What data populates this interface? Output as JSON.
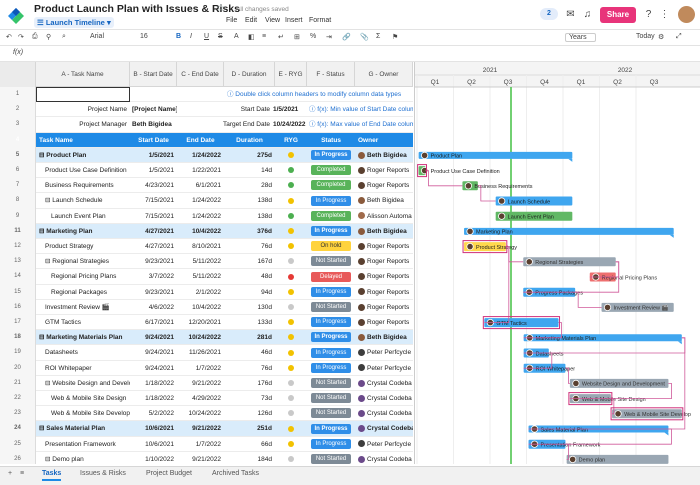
{
  "app": {
    "title": "Product Launch Plan with Issues & Risks",
    "saved_status": "All changes saved",
    "view_selector": "Launch Timeline",
    "menus": [
      "File",
      "Edit",
      "View",
      "Insert",
      "Format"
    ],
    "share_label": "Share",
    "collab_count": "2"
  },
  "toolbar": {
    "font": "Arial",
    "size": "16",
    "bold": "B",
    "italic": "I",
    "underline": "U",
    "strike": "S",
    "zoom_select": "Years",
    "today_label": "Today"
  },
  "formula_bar": {
    "label": "f(x)"
  },
  "columns": {
    "a": "A - Task Name",
    "b": "B - Start Date",
    "c": "C - End Date",
    "d": "D - Duration",
    "e": "E - RYG",
    "f": "F - Status",
    "g": "G - Owner"
  },
  "meta_rows": [
    {
      "num": "1",
      "label": "",
      "value": "",
      "label2": "",
      "value2": "",
      "hint": "Double click column headers to modify column data types"
    },
    {
      "num": "2",
      "label": "Project Name",
      "value": "[Project Name]",
      "label2": "Start Date",
      "value2": "1/5/2021",
      "hint": "f(x): Min value of Start Date colum"
    },
    {
      "num": "3",
      "label": "Project Manager",
      "value": "Beth Bigidea",
      "label2": "Target End Date",
      "value2": "10/24/2022",
      "hint": "f(x): Max value of End Date colum"
    }
  ],
  "table_header": {
    "num": "4",
    "task": "Task Name",
    "start": "Start Date",
    "end": "End Date",
    "duration": "Duration",
    "ryg": "RYG",
    "status": "Status",
    "owner": "Owner"
  },
  "rows": [
    {
      "num": "5",
      "task": "Product Plan",
      "start": "1/5/2021",
      "end": "1/24/2022",
      "duration": "275d",
      "ryg": "yellow",
      "status": "In Progress",
      "owner": "Beth Bigidea",
      "group": true,
      "indent": 0
    },
    {
      "num": "6",
      "task": "Product Use Case Definition",
      "start": "1/5/2021",
      "end": "1/22/2021",
      "duration": "14d",
      "ryg": "green",
      "status": "Completed",
      "owner": "Roger Reports",
      "group": false,
      "indent": 1
    },
    {
      "num": "7",
      "task": "Business Requirements",
      "start": "4/23/2021",
      "end": "6/1/2021",
      "duration": "28d",
      "ryg": "green",
      "status": "Completed",
      "owner": "Roger Reports",
      "group": false,
      "indent": 1
    },
    {
      "num": "8",
      "task": "Launch Schedule",
      "start": "7/15/2021",
      "end": "1/24/2022",
      "duration": "138d",
      "ryg": "yellow",
      "status": "In Progress",
      "owner": "Beth Bigidea",
      "group": false,
      "indent": 1
    },
    {
      "num": "9",
      "task": "Launch Event Plan",
      "start": "7/15/2021",
      "end": "1/24/2022",
      "duration": "138d",
      "ryg": "green",
      "status": "Completed",
      "owner": "Alisson Automa",
      "group": false,
      "indent": 2
    },
    {
      "num": "11",
      "task": "Marketing Plan",
      "start": "4/27/2021",
      "end": "10/4/2022",
      "duration": "376d",
      "ryg": "yellow",
      "status": "In Progress",
      "owner": "Beth Bigidea",
      "group": true,
      "indent": 0
    },
    {
      "num": "12",
      "task": "Product Strategy",
      "start": "4/27/2021",
      "end": "8/10/2021",
      "duration": "76d",
      "ryg": "yellow",
      "status": "On hold",
      "owner": "Roger Reports",
      "group": false,
      "indent": 1
    },
    {
      "num": "13",
      "task": "Regional Strategies",
      "start": "9/23/2021",
      "end": "5/11/2022",
      "duration": "167d",
      "ryg": "grey",
      "status": "Not Started",
      "owner": "Roger Reports",
      "group": false,
      "indent": 1
    },
    {
      "num": "14",
      "task": "Regional Pricing Plans",
      "start": "3/7/2022",
      "end": "5/11/2022",
      "duration": "48d",
      "ryg": "red",
      "status": "Delayed",
      "owner": "Roger Reports",
      "group": false,
      "indent": 2
    },
    {
      "num": "15",
      "task": "Regional Packages",
      "start": "9/23/2021",
      "end": "2/1/2022",
      "duration": "94d",
      "ryg": "yellow",
      "status": "In Progress",
      "owner": "Roger Reports",
      "group": false,
      "indent": 2
    },
    {
      "num": "16",
      "task": "Investment Review 🎬",
      "start": "4/6/2022",
      "end": "10/4/2022",
      "duration": "130d",
      "ryg": "grey",
      "status": "Not Started",
      "owner": "Roger Reports",
      "group": false,
      "indent": 1
    },
    {
      "num": "17",
      "task": "GTM Tactics",
      "start": "6/17/2021",
      "end": "12/20/2021",
      "duration": "133d",
      "ryg": "yellow",
      "status": "In Progress",
      "owner": "Roger Reports",
      "group": false,
      "indent": 1
    },
    {
      "num": "18",
      "task": "Marketing Materials Plan",
      "start": "9/24/2021",
      "end": "10/24/2022",
      "duration": "281d",
      "ryg": "yellow",
      "status": "In Progress",
      "owner": "Beth Bigidea",
      "group": true,
      "indent": 0
    },
    {
      "num": "19",
      "task": "Datasheets",
      "start": "9/24/2021",
      "end": "11/26/2021",
      "duration": "46d",
      "ryg": "yellow",
      "status": "In Progress",
      "owner": "Peter Perfcycle",
      "group": false,
      "indent": 1
    },
    {
      "num": "20",
      "task": "ROI Whitepaper",
      "start": "9/24/2021",
      "end": "1/7/2022",
      "duration": "76d",
      "ryg": "yellow",
      "status": "In Progress",
      "owner": "Peter Perfcycle",
      "group": false,
      "indent": 1
    },
    {
      "num": "21",
      "task": "Website Design and Develop",
      "start": "1/18/2022",
      "end": "9/21/2022",
      "duration": "176d",
      "ryg": "grey",
      "status": "Not Started",
      "owner": "Crystal Codeba",
      "group": false,
      "indent": 1
    },
    {
      "num": "22",
      "task": "Web & Mobile Site Design",
      "start": "1/18/2022",
      "end": "4/29/2022",
      "duration": "73d",
      "ryg": "grey",
      "status": "Not Started",
      "owner": "Crystal Codeba",
      "group": false,
      "indent": 2
    },
    {
      "num": "23",
      "task": "Web & Mobile Site Develop",
      "start": "5/2/2022",
      "end": "10/24/2022",
      "duration": "126d",
      "ryg": "grey",
      "status": "Not Started",
      "owner": "Crystal Codeba",
      "group": false,
      "indent": 2
    },
    {
      "num": "24",
      "task": "Sales Material Plan",
      "start": "10/6/2021",
      "end": "9/21/2022",
      "duration": "251d",
      "ryg": "yellow",
      "status": "In Progress",
      "owner": "Crystal Codeba",
      "group": true,
      "indent": 0
    },
    {
      "num": "25",
      "task": "Presentation Framework",
      "start": "10/6/2021",
      "end": "1/7/2022",
      "duration": "66d",
      "ryg": "yellow",
      "status": "In Progress",
      "owner": "Peter Perfcycle",
      "group": false,
      "indent": 1
    },
    {
      "num": "26",
      "task": "Demo plan",
      "start": "1/10/2022",
      "end": "9/21/2022",
      "duration": "184d",
      "ryg": "grey",
      "status": "Not Started",
      "owner": "Crystal Codeba",
      "group": false,
      "indent": 1
    }
  ],
  "gantt": {
    "years": [
      "2021",
      "2022"
    ],
    "quarters": [
      "Q1",
      "Q2",
      "Q3",
      "Q4",
      "Q1",
      "Q2",
      "Q3"
    ],
    "bar_labels": [
      "Product Plan",
      "Product Use Case Definition",
      "Business Requirements",
      "Launch Schedule",
      "Launch Event Plan",
      "Marketing Plan",
      "Product Strategy",
      "Regional Strategies",
      "Regional Pricing Plans",
      "Progress Packages",
      "Investment Review 🎬",
      "GTM Tactics",
      "Marketing Materials Plan",
      "Datasheets",
      "ROI Whitepaper",
      "Website Design and Development",
      "Web & Mobile Site Design",
      "Web & Mobile Site Develop",
      "Sales Material Plan",
      "Presentation Framework",
      "Demo plan"
    ]
  },
  "sheet_tabs": [
    "Tasks",
    "Issues & Risks",
    "Project Budget",
    "Archived Tasks"
  ],
  "colors": {
    "brand_pink": "#e8347a",
    "header_blue": "#1e8ae6",
    "group_bg": "#d9ecfb",
    "in_progress": "#2f8ee8",
    "completed": "#58b35a",
    "not_started": "#7d8a96",
    "delayed": "#e85a5a",
    "on_hold": "#ffd33d",
    "today_line": "#44c044"
  }
}
